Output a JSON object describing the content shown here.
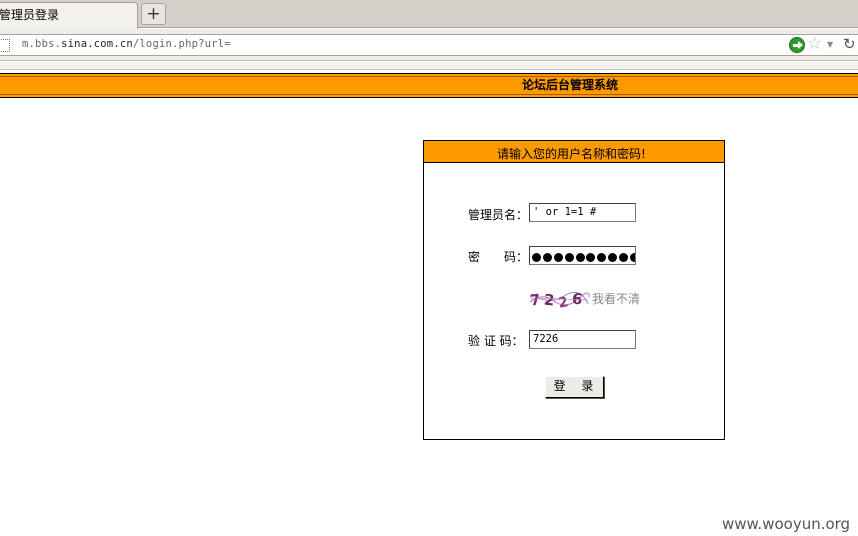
{
  "browser": {
    "tab_title": "管理员登录",
    "new_tab": "+",
    "url_host_prefix": "m.bbs.",
    "url_host_domain": "sina.com.cn",
    "url_path": "/login.php?url="
  },
  "page": {
    "header_title": "论坛后台管理系统"
  },
  "login": {
    "prompt": "请输入您的用户名称和密码!",
    "username_label": "管理员名：",
    "username_value": "' or 1=1 #",
    "password_label_1": "密",
    "password_label_2": "码：",
    "password_mask_count": 10,
    "captcha_image_text": "7226",
    "captcha_hint": "我看不清",
    "captcha_label": "验 证 码：",
    "captcha_value": "7226",
    "submit_label": "登 录"
  },
  "watermark": "www.wooyun.org",
  "colors": {
    "header_orange": "#fe9900",
    "border": "#000000",
    "go_green": "#2e9b2b"
  },
  "icons": [
    "page-icon",
    "go-arrow-icon",
    "star-icon",
    "dropdown-icon",
    "reload-icon"
  ]
}
